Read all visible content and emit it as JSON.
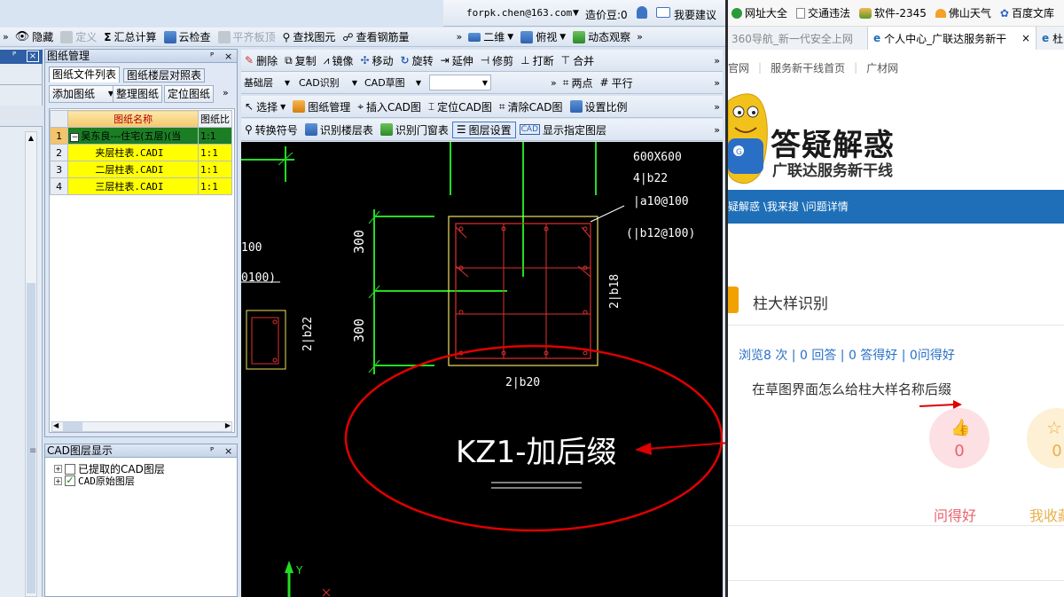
{
  "app": {
    "user_email": "forpk.chen@163.com",
    "balance_label": "造价豆:0",
    "suggest_label": "我要建议",
    "main_toolbar": [
      "隐藏",
      "定义",
      "汇总计算",
      "云检查",
      "平齐板顶",
      "查找图元",
      "查看钢筋量"
    ],
    "view_toolbar": [
      "二维",
      "俯视",
      "动态观察"
    ],
    "edit_toolbar": [
      "删除",
      "复制",
      "镜像",
      "移动",
      "旋转",
      "延伸",
      "修剪",
      "打断",
      "合并"
    ],
    "layer_select": "基础层",
    "cad_select": "CAD识别",
    "cad_draft_select": "CAD草图",
    "point_tools": [
      "两点",
      "平行"
    ],
    "cad_toolbar": [
      "选择",
      "图纸管理",
      "插入CAD图",
      "定位CAD图",
      "清除CAD图",
      "设置比例"
    ],
    "cad_toolbar2": [
      "转换符号",
      "识别楼层表",
      "识别门窗表",
      "图层设置",
      "显示指定图层"
    ]
  },
  "drawing_panel": {
    "title": "图纸管理",
    "tabs": [
      "图纸文件列表",
      "图纸楼层对照表"
    ],
    "buttons": [
      "添加图纸",
      "整理图纸",
      "定位图纸"
    ],
    "columns": [
      "图纸名称",
      "图纸比"
    ],
    "rows": [
      {
        "num": "1",
        "name": "吴东良---住宅(五层)(当",
        "ratio": "1:1"
      },
      {
        "num": "2",
        "name": "夹层柱表.CADI",
        "ratio": "1:1"
      },
      {
        "num": "3",
        "name": "二层柱表.CADI",
        "ratio": "1:1"
      },
      {
        "num": "4",
        "name": "三层柱表.CADI",
        "ratio": "1:1"
      }
    ]
  },
  "layer_panel": {
    "title": "CAD图层显示",
    "items": [
      {
        "label": "已提取的CAD图层",
        "checked": false
      },
      {
        "label": "CAD原始图层",
        "checked": true
      }
    ]
  },
  "cad": {
    "size_label": "600X600",
    "rebar1": "4|b22",
    "rebar2": "|a10@100",
    "rebar3": "(|b12@100)",
    "left_text1": "100",
    "left_text2": "0100)",
    "dim1": "300",
    "dim2": "300",
    "side_left": "2|b22",
    "side_right": "2|b18",
    "bottom_label": "2|b20",
    "annotation": "KZ1-加后缀",
    "axis_y": "Y"
  },
  "browser": {
    "bookmarks": [
      "网址大全",
      "交通违法",
      "软件-2345",
      "佛山天气",
      "百度文库"
    ],
    "tabs": [
      "360导航_新一代安全上网",
      "个人中心_广联达服务新干",
      "杜"
    ],
    "nav_links": [
      "官网",
      "服务新干线首页",
      "广材网"
    ],
    "banner_title": "答疑解惑",
    "banner_subtitle": "广联达服务新干线",
    "breadcrumb": "疑解惑 \\我来搜 \\问题详情",
    "question_title": "柱大样识别",
    "stats": "浏览8 次 | 0 回答 | 0 答得好 | 0问得好",
    "question_body": "在草图界面怎么给柱大样名称后缀",
    "like_count": "0",
    "like_label": "问得好",
    "fav_count": "0",
    "fav_label": "我收藏",
    "colors": {
      "accent": "#1e6fb8",
      "annotation": "#e00000"
    }
  }
}
